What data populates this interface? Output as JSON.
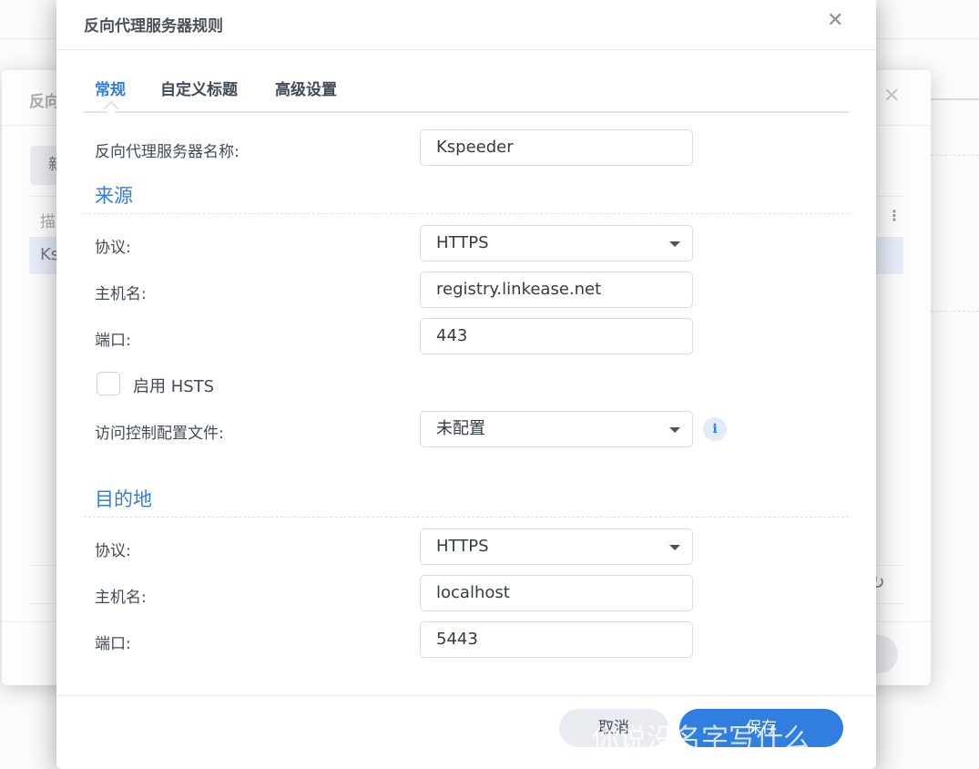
{
  "background_dialog": {
    "title": "反向",
    "new_button": "新",
    "column_description": "描",
    "row_name": "Ks"
  },
  "dialog": {
    "title": "反向代理服务器规则",
    "tabs": [
      {
        "label": "常规",
        "active": true
      },
      {
        "label": "自定义标题"
      },
      {
        "label": "高级设置"
      }
    ],
    "name_label": "反向代理服务器名称:",
    "name_value": "Kspeeder",
    "source": {
      "heading": "来源",
      "protocol_label": "协议:",
      "protocol_value": "HTTPS",
      "hostname_label": "主机名:",
      "hostname_value": "registry.linkease.net",
      "port_label": "端口:",
      "port_value": "443",
      "hsts_label": "启用 HSTS",
      "hsts_checked": false,
      "acl_label": "访问控制配置文件:",
      "acl_value": "未配置"
    },
    "destination": {
      "heading": "目的地",
      "protocol_label": "协议:",
      "protocol_value": "HTTPS",
      "hostname_label": "主机名:",
      "hostname_value": "localhost",
      "port_label": "端口:",
      "port_value": "5443"
    },
    "cancel_label": "取消",
    "save_label": "保存"
  },
  "watermark": "你说没名字写什么",
  "colors": {
    "accent": "#2f7ee0"
  }
}
